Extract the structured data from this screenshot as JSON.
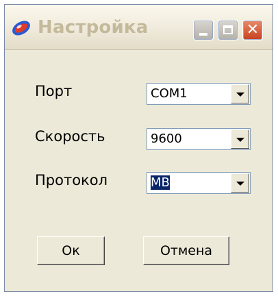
{
  "window": {
    "title": "Настройка"
  },
  "titlebar_buttons": {
    "minimize_icon": "minimize-icon",
    "maximize_icon": "maximize-icon",
    "close_icon": "close-icon",
    "close_glyph": "✕"
  },
  "form": {
    "port": {
      "label": "Порт",
      "value": "COM1"
    },
    "speed": {
      "label": "Скорость",
      "value": "9600"
    },
    "protocol": {
      "label": "Протокол",
      "value": "MB"
    }
  },
  "buttons": {
    "ok": "Ок",
    "cancel": "Отмена"
  },
  "colors": {
    "close": "#c7411e",
    "selection": "#0a246a",
    "window_bg": "#ece9d8"
  }
}
